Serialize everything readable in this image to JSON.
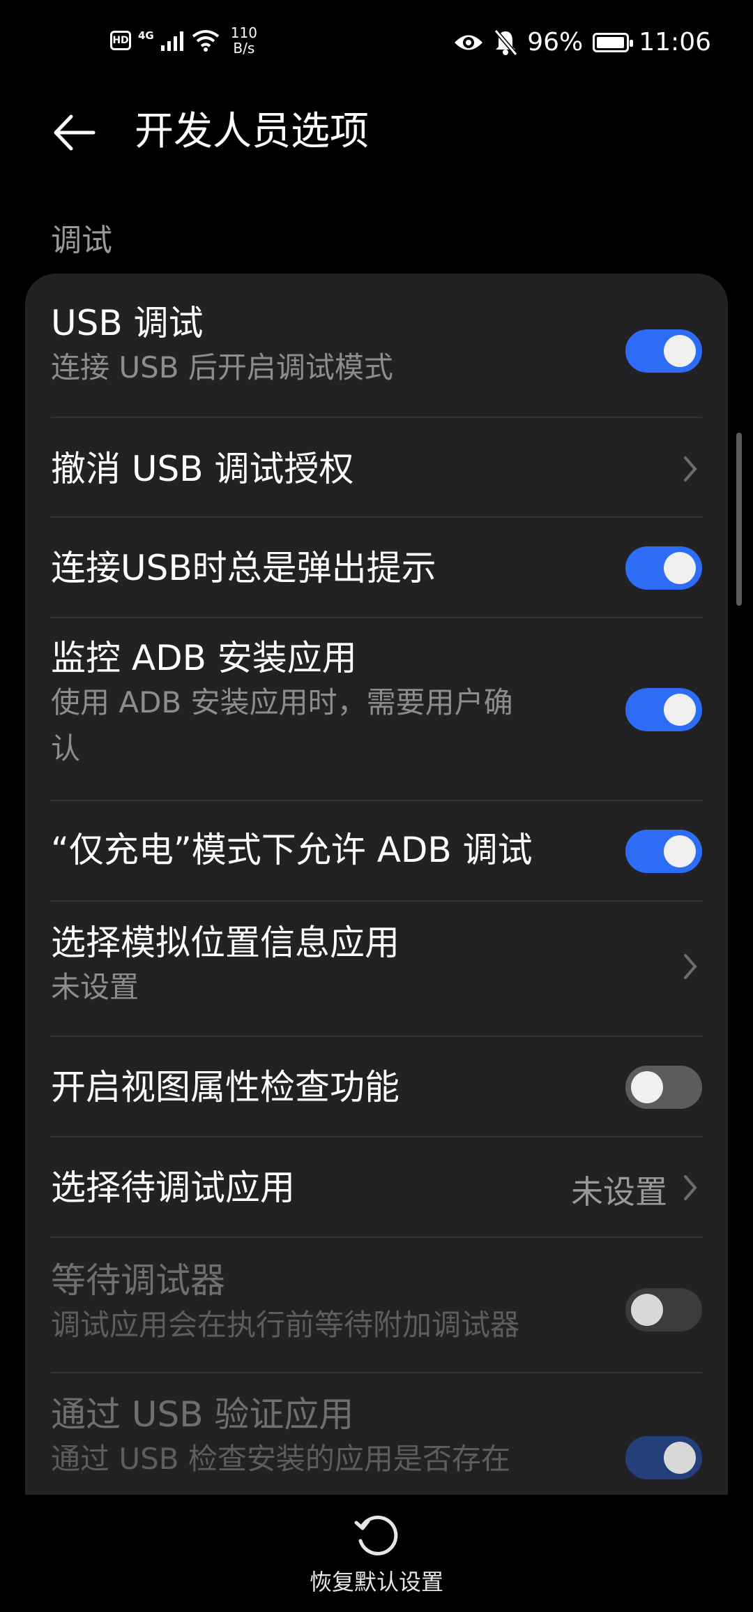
{
  "status_bar": {
    "hd": "HD",
    "network_type": "4G",
    "speed_value": "110",
    "speed_unit": "B/s",
    "battery": "96%",
    "time": "11:06"
  },
  "header": {
    "title": "开发人员选项"
  },
  "section": {
    "label": "调试"
  },
  "items": [
    {
      "title": "USB 调试",
      "subtitle": "连接 USB 后开启调试模式",
      "control": "toggle",
      "on": true
    },
    {
      "title": "撤消 USB 调试授权",
      "control": "chevron"
    },
    {
      "title": "连接USB时总是弹出提示",
      "control": "toggle",
      "on": true
    },
    {
      "title": "监控 ADB 安装应用",
      "subtitle_line1": "使用 ADB 安装应用时，需要用户确",
      "subtitle_line2": "认",
      "control": "toggle",
      "on": true
    },
    {
      "title": "“仅充电”模式下允许 ADB 调试",
      "control": "toggle",
      "on": true
    },
    {
      "title": "选择模拟位置信息应用",
      "subtitle": "未设置",
      "control": "chevron"
    },
    {
      "title": "开启视图属性检查功能",
      "control": "toggle",
      "on": false
    },
    {
      "title": "选择待调试应用",
      "value": "未设置",
      "control": "chevron"
    },
    {
      "title": "等待调试器",
      "subtitle": "调试应用会在执行前等待附加调试器",
      "control": "toggle",
      "on": false,
      "disabled": true
    },
    {
      "title": "通过 USB 验证应用",
      "subtitle": "通过 USB 检查安装的应用是否存在",
      "control": "toggle",
      "on": true,
      "disabled": true
    }
  ],
  "footer": {
    "reset_label": "恢复默认设置"
  },
  "colors": {
    "accent": "#2d6cf6",
    "card_bg": "#222224",
    "background": "#000000"
  }
}
